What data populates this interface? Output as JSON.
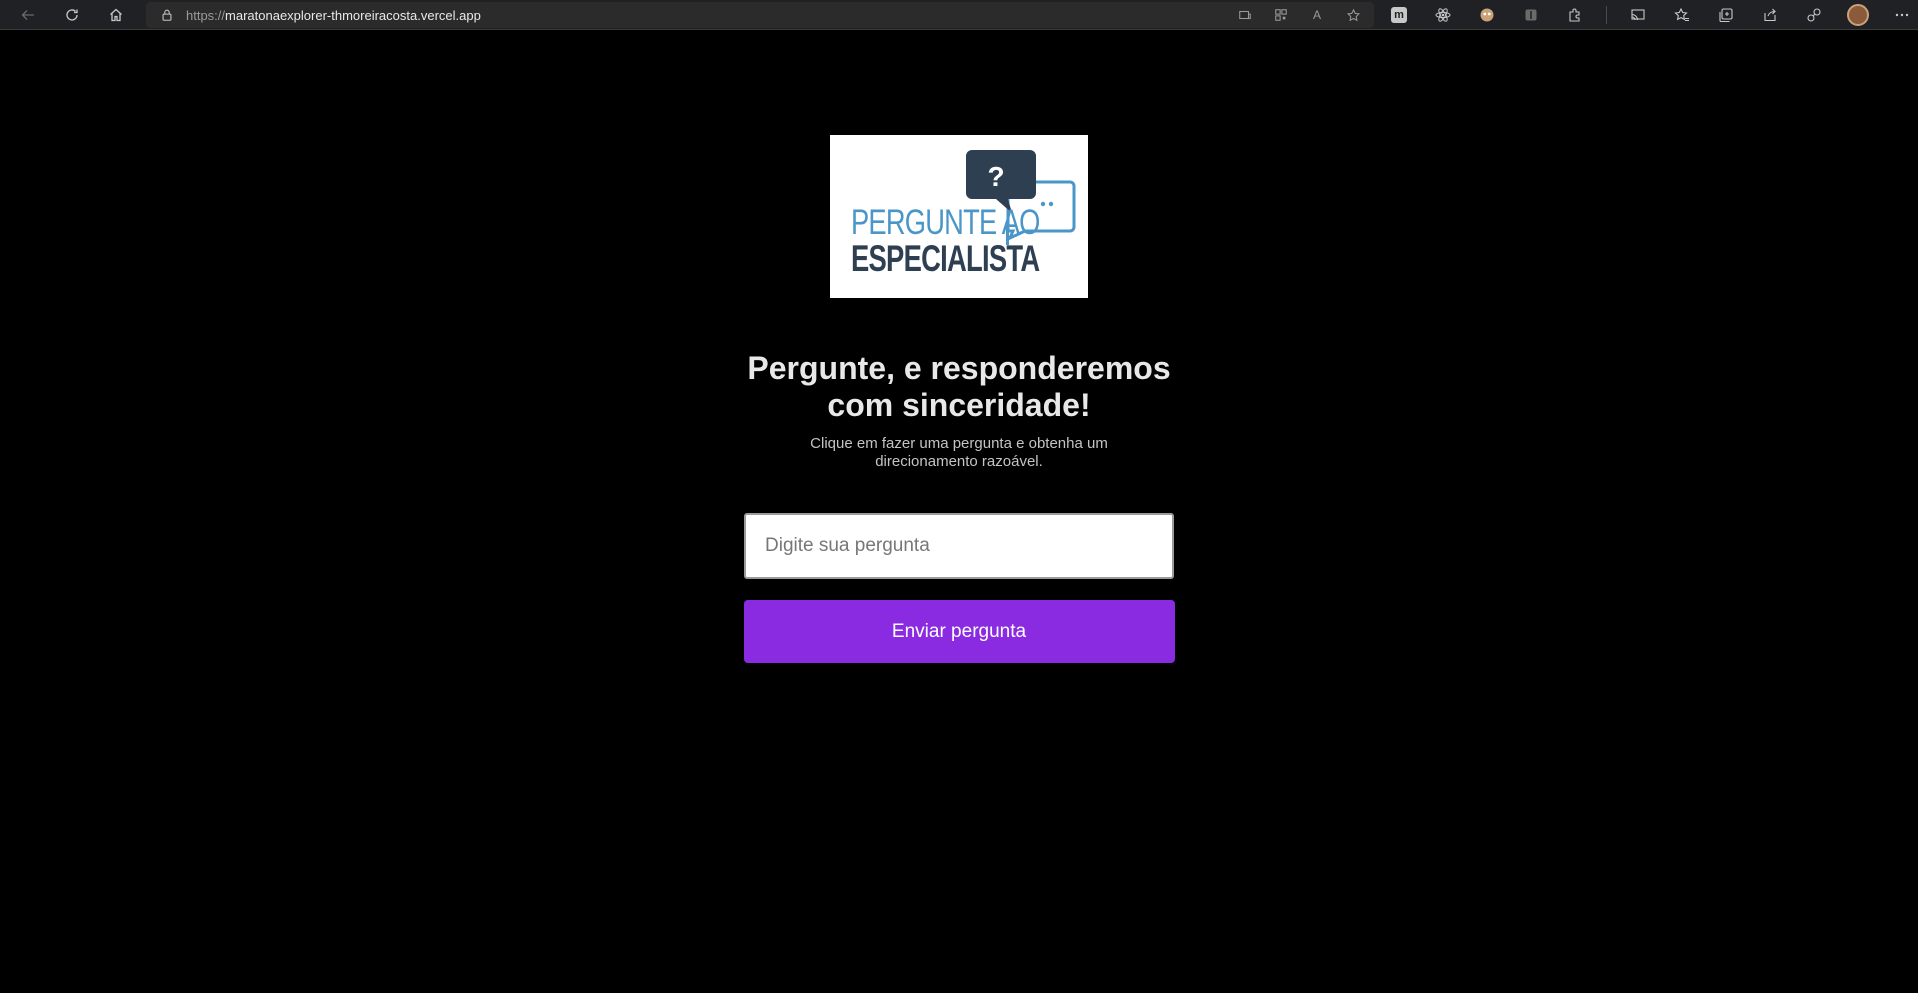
{
  "browser": {
    "url_scheme": "https://",
    "url_host": "maratonaexplorer-thmoreiracosta.vercel.app",
    "extension_m_label": "m",
    "read_aloud_label": "A"
  },
  "logo": {
    "line1": "PERGUNTE AO",
    "line2": "ESPECIALISTA",
    "bubble_mark": "?",
    "colors": {
      "dark": "#2f3f52",
      "light": "#4a96c8"
    }
  },
  "hero": {
    "title": "Pergunte, e responderemos com sinceridade!",
    "subtitle": "Clique em fazer uma pergunta e obtenha um direcionamento razoável."
  },
  "form": {
    "input_placeholder": "Digite sua pergunta",
    "input_value": "",
    "submit_label": "Enviar pergunta"
  },
  "colors": {
    "background": "#000000",
    "button": "#8a2be2"
  }
}
